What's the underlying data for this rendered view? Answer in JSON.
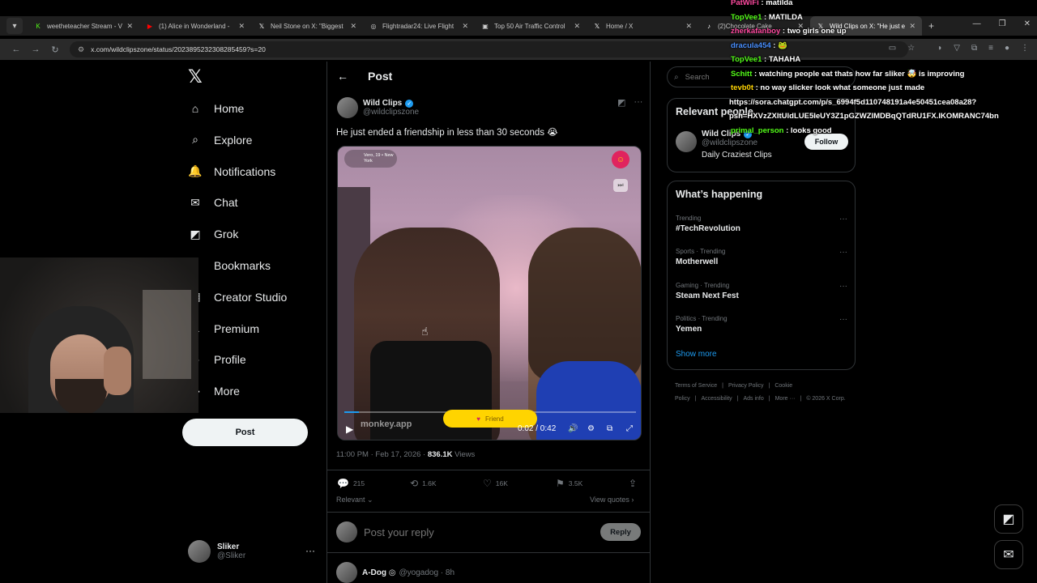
{
  "browser": {
    "tabs": [
      {
        "title": "weetheteacher Stream - V",
        "icon": "K",
        "color": "#53fc18"
      },
      {
        "title": "(1) Alice in Wonderland -",
        "icon": "▶",
        "color": "#ff0000"
      },
      {
        "title": "Neil Stone on X: \"Biggest",
        "icon": "𝕏",
        "color": "#ffffff"
      },
      {
        "title": "Flightradar24: Live Flight",
        "icon": "◎",
        "color": "#cccccc"
      },
      {
        "title": "Top 50 Air Traffic Control",
        "icon": "▣",
        "color": "#cccccc"
      },
      {
        "title": "Home / X",
        "icon": "𝕏",
        "color": "#ffffff"
      },
      {
        "title": "(2)Chocolate Cake",
        "icon": "♪",
        "color": "#ffffff"
      },
      {
        "title": "Wild Clips on X: \"He just e",
        "icon": "𝕏",
        "color": "#ffffff"
      }
    ],
    "url": "x.com/wildclipszone/status/2023895232308285459?s=20"
  },
  "nav": {
    "items": [
      {
        "label": "Home",
        "icon": "⌂",
        "icon_name": "home-icon"
      },
      {
        "label": "Explore",
        "icon": "⌕",
        "icon_name": "search-icon"
      },
      {
        "label": "Notifications",
        "icon": "🔔",
        "icon_name": "bell-icon"
      },
      {
        "label": "Chat",
        "icon": "✉",
        "icon_name": "mail-icon"
      },
      {
        "label": "Grok",
        "icon": "◩",
        "icon_name": "grok-icon"
      },
      {
        "label": "Bookmarks",
        "icon": "⚑",
        "icon_name": "bookmark-icon"
      },
      {
        "label": "Creator Studio",
        "icon": "▤",
        "icon_name": "creator-studio-icon"
      },
      {
        "label": "Premium",
        "icon": "𝕏",
        "icon_name": "premium-icon"
      },
      {
        "label": "Profile",
        "icon": "☺",
        "icon_name": "person-icon"
      },
      {
        "label": "More",
        "icon": "⋯",
        "icon_name": "more-icon"
      }
    ],
    "post_label": "Post",
    "account": {
      "name": "Sliker",
      "handle": "@Sliker"
    }
  },
  "post": {
    "header_title": "Post",
    "author_name": "Wild Clips",
    "author_handle": "@wildclipszone",
    "text": "He just ended a friendship in less than 30 seconds 😭",
    "video": {
      "badge_text": "Vero, 19 • New York",
      "watermark": "monkey.app",
      "friend_label": "Friend",
      "time": "0:02 / 0:42",
      "progress": 0.05
    },
    "timestamp": "11:00 PM · Feb 17, 2026 · ",
    "views_count": "836.1K",
    "views_label": " Views",
    "replies": "215",
    "reposts": "1.6K",
    "likes": "16K",
    "bookmarks": "3.5K",
    "sort_label": "Relevant",
    "view_quotes": "View quotes",
    "reply_placeholder": "Post your reply",
    "reply_button": "Reply",
    "next_reply_name": "A-Dog ◎",
    "next_reply_handle": "@yogadog · 8h"
  },
  "sidebar": {
    "search_placeholder": "Search",
    "relevant_title": "Relevant people",
    "rp_name": "Wild Clips",
    "rp_handle": "@wildclipszone",
    "rp_bio": "Daily Craziest Clips",
    "follow_label": "Follow",
    "happening_title": "What’s happening",
    "trends": [
      {
        "context": "Trending",
        "name": "#TechRevolution"
      },
      {
        "context": "Sports · Trending",
        "name": "Motherwell"
      },
      {
        "context": "Gaming · Trending",
        "name": "Steam Next Fest"
      },
      {
        "context": "Politics · Trending",
        "name": "Yemen"
      }
    ],
    "show_more": "Show more",
    "footer": [
      "Terms of Service",
      "|",
      "Privacy Policy",
      "|",
      "Cookie Policy",
      "|",
      "Accessibility",
      "|",
      "Ads info",
      "|",
      "More ···",
      "|",
      "© 2026 X Corp."
    ]
  },
  "chat": [
    {
      "user": "PatWiFi",
      "text": " : matilda",
      "color": "#ff4aa0"
    },
    {
      "user": "TopVee1",
      "text": " : MATILDA",
      "color": "#53fc18"
    },
    {
      "user": "zherkafanboy",
      "text": " : two girls one up",
      "color": "#ff4aa0"
    },
    {
      "user": "dracula454",
      "text": " : 🐸",
      "color": "#4a90ff"
    },
    {
      "user": "TopVee1",
      "text": " : TAHAHA",
      "color": "#53fc18"
    },
    {
      "user": "Schitt",
      "text": " : watching people eat thats how far sliker 🤯 is improving",
      "color": "#53fc18"
    },
    {
      "user": "tevb0t",
      "text": " : no way slicker look what someone just made",
      "color": "#ffd400"
    },
    {
      "user": "",
      "text": "https://sora.chatgpt.com/p/s_6994f5d110748191a4e50451cea08a28?",
      "color": "#ffffff"
    },
    {
      "user": "",
      "text": "psh=HXVzZXItUldLUE5IeUY3Z1pGZWZIMDBqQTdRU1FX.IKOMRANC74bn",
      "color": "#ffffff"
    },
    {
      "user": "primal_person",
      "text": " : looks good",
      "color": "#53fc18"
    }
  ]
}
